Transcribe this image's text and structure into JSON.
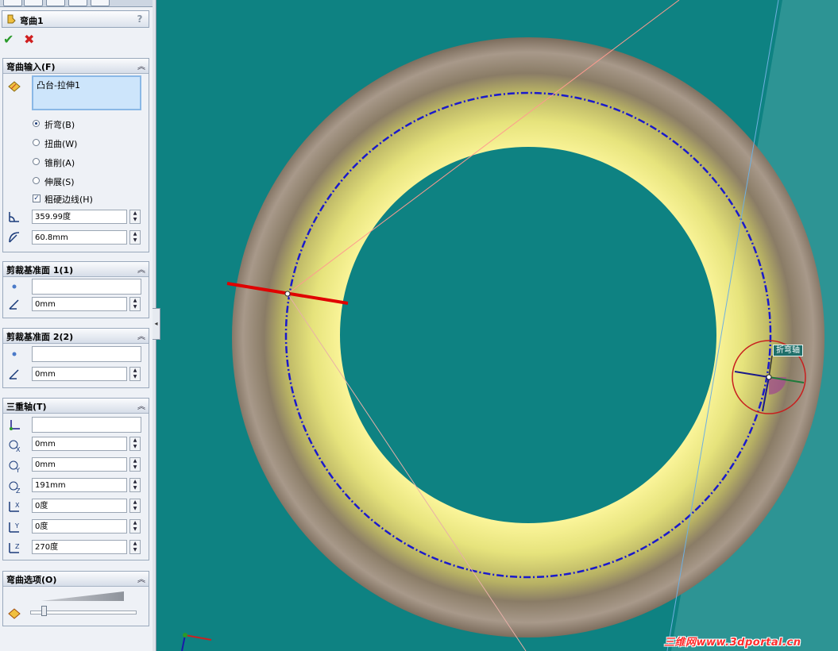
{
  "feature": {
    "title": "弯曲1",
    "help": "?"
  },
  "bend_input": {
    "header": "弯曲输入(F)",
    "body": "凸台-拉伸1",
    "options": [
      {
        "label": "折弯(B)",
        "selected": true
      },
      {
        "label": "扭曲(W)",
        "selected": false
      },
      {
        "label": "锥削(A)",
        "selected": false
      },
      {
        "label": "伸展(S)",
        "selected": false
      }
    ],
    "rigid_edges": {
      "label": "粗硬边线(H)",
      "checked": true
    },
    "angle": "359.99度",
    "radius": "60.8mm"
  },
  "trim_plane_1": {
    "header": "剪裁基准面 1(1)",
    "ref": "",
    "distance": "0mm"
  },
  "trim_plane_2": {
    "header": "剪裁基准面 2(2)",
    "ref": "",
    "distance": "0mm"
  },
  "triad": {
    "header": "三重轴(T)",
    "ref": "",
    "x": "0mm",
    "y": "0mm",
    "z": "191mm",
    "rot_x": "0度",
    "rot_y": "0度",
    "rot_z": "270度"
  },
  "bend_options": {
    "header": "弯曲选项(O)",
    "accuracy_level": 0.15
  },
  "viewport": {
    "bend_axis_label": "折弯轴",
    "watermark": "三维网www.3dportal.cn"
  },
  "colors": {
    "background": "#0e8282",
    "ring_outer": "#8e7f68",
    "ring_inner": "#e6e47f",
    "bend_line": "#1a1acb",
    "trim_line": "#e00000",
    "triad_circle": "#c81e1e"
  }
}
